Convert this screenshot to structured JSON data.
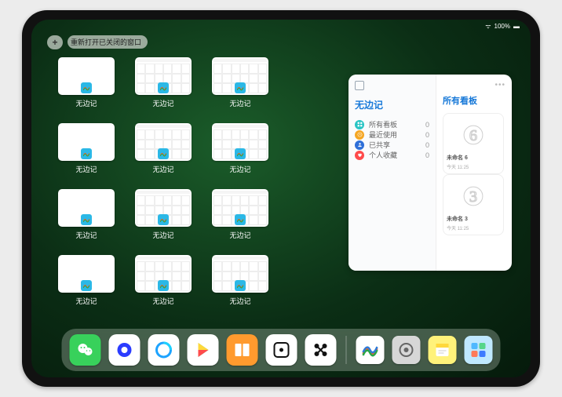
{
  "status": {
    "time": "",
    "battery": "100%",
    "wifi": "●●●"
  },
  "topbar": {
    "plus": "+",
    "pill_label": "重新打开已关闭的窗口"
  },
  "tiles": [
    {
      "type": "blank",
      "label": "无边记"
    },
    {
      "type": "cal",
      "label": "无边记"
    },
    {
      "type": "cal",
      "label": "无边记"
    },
    {
      "type": "blank",
      "label": "无边记"
    },
    {
      "type": "cal",
      "label": "无边记"
    },
    {
      "type": "cal",
      "label": "无边记"
    },
    {
      "type": "blank",
      "label": "无边记"
    },
    {
      "type": "cal",
      "label": "无边记"
    },
    {
      "type": "cal",
      "label": "无边记"
    },
    {
      "type": "blank",
      "label": "无边记"
    },
    {
      "type": "cal",
      "label": "无边记"
    },
    {
      "type": "cal",
      "label": "无边记"
    }
  ],
  "tile_placement": [
    0,
    1,
    2,
    0,
    1,
    2,
    0,
    1,
    2,
    0,
    1,
    2
  ],
  "panel": {
    "title": "无边记",
    "rows": [
      {
        "icon": "grid",
        "color": "#28c4c4",
        "label": "所有看板",
        "count": "0"
      },
      {
        "icon": "clock",
        "color": "#f5a623",
        "label": "最近使用",
        "count": "0"
      },
      {
        "icon": "person",
        "color": "#2e6fd8",
        "label": "已共享",
        "count": "0"
      },
      {
        "icon": "heart",
        "color": "#ff4b4b",
        "label": "个人收藏",
        "count": "0"
      }
    ],
    "right_title": "所有看板",
    "cards": [
      {
        "sketch": "6",
        "caption": "未命名 6",
        "sub": "今天 11:25"
      },
      {
        "sketch": "3",
        "caption": "未命名 3",
        "sub": "今天 11:25"
      }
    ]
  },
  "dock": {
    "main": [
      {
        "name": "wechat-icon",
        "bg": "#38d15b"
      },
      {
        "name": "quark-icon",
        "bg": "#ffffff"
      },
      {
        "name": "qqbrowser-icon",
        "bg": "#ffffff"
      },
      {
        "name": "play-icon",
        "bg": "#ffffff"
      },
      {
        "name": "books-icon",
        "bg": "#ff9a2e"
      },
      {
        "name": "dice-icon",
        "bg": "#ffffff"
      },
      {
        "name": "connect-icon",
        "bg": "#ffffff"
      }
    ],
    "recent": [
      {
        "name": "freeform-icon",
        "bg": "#ffffff"
      },
      {
        "name": "settings-icon",
        "bg": "#d7d7d7"
      },
      {
        "name": "notes-icon",
        "bg": "#fff27a"
      },
      {
        "name": "apps-icon",
        "bg": "#bfe8ff"
      }
    ]
  }
}
